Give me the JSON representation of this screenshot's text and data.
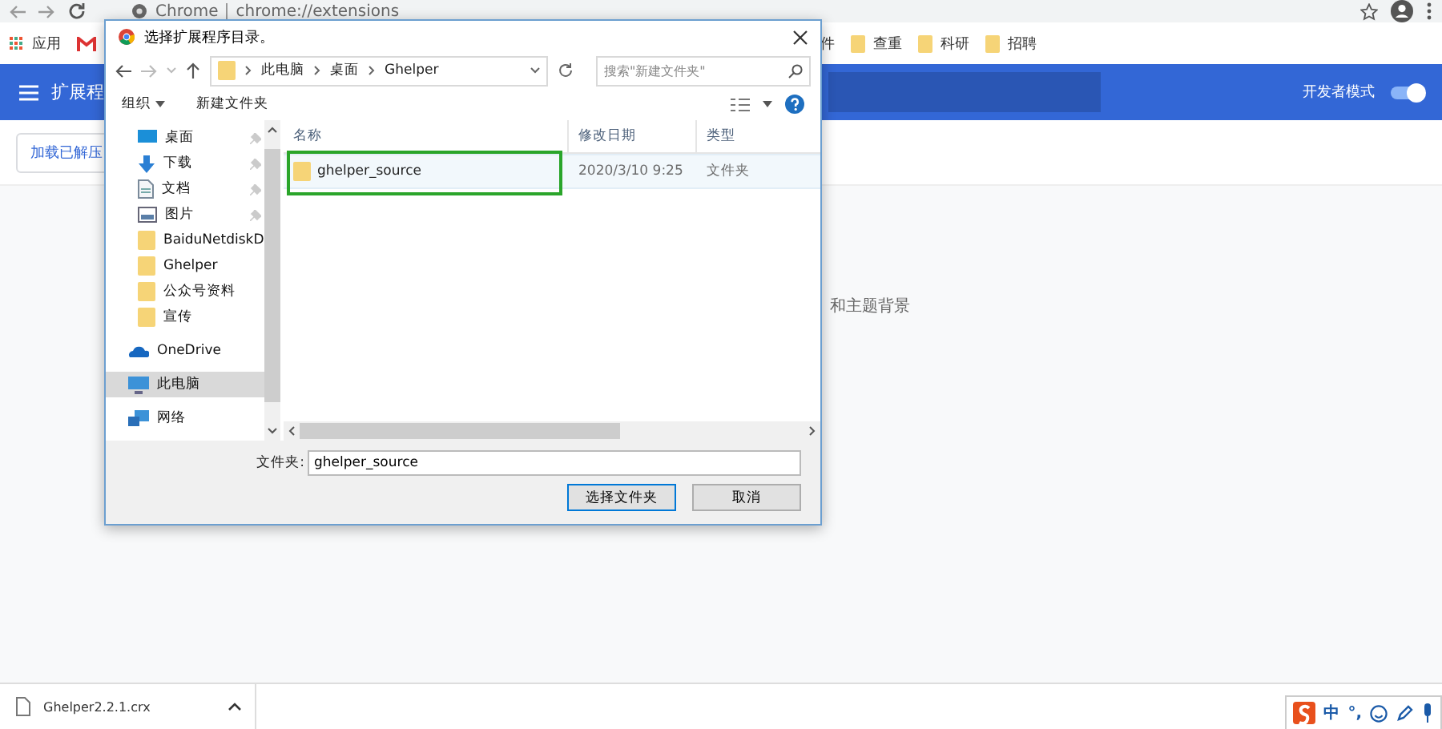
{
  "browser": {
    "site": "Chrome",
    "url": "chrome://extensions"
  },
  "bookmarks": [
    {
      "kind": "apps",
      "label": "应用"
    },
    {
      "kind": "gmail"
    },
    {
      "kind": "text",
      "label": "件"
    },
    {
      "kind": "folder",
      "label": "查重"
    },
    {
      "kind": "folder",
      "label": "科研"
    },
    {
      "kind": "folder",
      "label": "招聘"
    }
  ],
  "extensions_page": {
    "title": "扩展程",
    "developer_mode_label": "开发者模式",
    "developer_mode": true,
    "load_button": "加载已解压",
    "body_text": "和主题背景"
  },
  "dialog": {
    "title": "选择扩展程序目录。",
    "breadcrumb": [
      "此电脑",
      "桌面",
      "Ghelper"
    ],
    "search_placeholder": "搜索\"新建文件夹\"",
    "organize": "组织",
    "new_folder": "新建文件夹",
    "nav_items": [
      {
        "kind": "desktop",
        "label": "桌面",
        "pinned": true,
        "selected": false
      },
      {
        "kind": "download",
        "label": "下载",
        "pinned": true,
        "selected": false
      },
      {
        "kind": "document",
        "label": "文档",
        "pinned": true,
        "selected": false
      },
      {
        "kind": "image",
        "label": "图片",
        "pinned": true,
        "selected": false
      },
      {
        "kind": "folder",
        "label": "BaiduNetdiskD",
        "pinned": false,
        "selected": false
      },
      {
        "kind": "folder",
        "label": "Ghelper",
        "pinned": false,
        "selected": false
      },
      {
        "kind": "folder",
        "label": "公众号资料",
        "pinned": false,
        "selected": false
      },
      {
        "kind": "folder",
        "label": "宣传",
        "pinned": false,
        "selected": false
      },
      {
        "kind": "cloud",
        "label": "OneDrive",
        "pinned": false,
        "selected": false
      },
      {
        "kind": "pc",
        "label": "此电脑",
        "pinned": false,
        "selected": true
      },
      {
        "kind": "network",
        "label": "网络",
        "pinned": false,
        "selected": false
      }
    ],
    "columns": [
      "名称",
      "修改日期",
      "类型"
    ],
    "rows": [
      {
        "name": "ghelper_source",
        "date": "2020/3/10 9:25",
        "type": "文件夹",
        "selected": true,
        "highlighted": true
      }
    ],
    "folder_label": "文件夹:",
    "folder_value": "ghelper_source",
    "buttons": [
      "选择文件夹",
      "取消"
    ]
  },
  "download": {
    "file": "Ghelper2.2.1.crx"
  },
  "ime": {
    "mode": "中",
    "punct": "°,"
  }
}
